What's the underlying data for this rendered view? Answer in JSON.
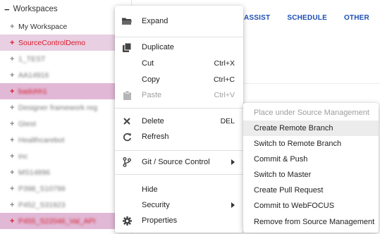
{
  "tree": {
    "root_label": "Workspaces",
    "items": [
      {
        "label": "My Workspace"
      },
      {
        "label": "SourceControlDemo"
      },
      {
        "label": "1_TEST"
      },
      {
        "label": "AA14916"
      },
      {
        "label": "badohh1"
      },
      {
        "label": "Designer framework reg"
      },
      {
        "label": "Gtest"
      },
      {
        "label": "Healthcarebot"
      },
      {
        "label": "inc"
      },
      {
        "label": "MS14896"
      },
      {
        "label": "P398_S10799"
      },
      {
        "label": "P452_S31923"
      },
      {
        "label": "P455_S22046_Val_API"
      }
    ]
  },
  "tabs": [
    {
      "label": "ASSIST"
    },
    {
      "label": "SCHEDULE"
    },
    {
      "label": "OTHER"
    }
  ],
  "context_menu": {
    "expand": "Expand",
    "duplicate": "Duplicate",
    "cut": "Cut",
    "cut_shortcut": "Ctrl+X",
    "copy": "Copy",
    "copy_shortcut": "Ctrl+C",
    "paste": "Paste",
    "paste_shortcut": "Ctrl+V",
    "delete": "Delete",
    "delete_shortcut": "DEL",
    "refresh": "Refresh",
    "git": "Git / Source Control",
    "hide": "Hide",
    "security": "Security",
    "properties": "Properties"
  },
  "submenu": {
    "items": [
      {
        "label": "Place under Source Management",
        "disabled": true
      },
      {
        "label": "Create Remote Branch",
        "hover": true
      },
      {
        "label": "Switch to Remote Branch"
      },
      {
        "label": "Commit & Push"
      },
      {
        "label": "Switch to Master"
      },
      {
        "label": "Create Pull Request"
      },
      {
        "label": "Commit to WebFOCUS"
      },
      {
        "label": "Remove from Source Management"
      }
    ]
  },
  "colors": {
    "accent_red": "#d91a2a",
    "tab_blue": "#1b4fb3",
    "selection_pink": "#e8cfe1",
    "hover_grey": "#ececec"
  },
  "icons": {
    "expand": "folder-icon",
    "duplicate": "duplicate-icon",
    "paste": "clipboard-icon",
    "delete": "close-icon",
    "refresh": "refresh-icon",
    "git": "git-branch-icon",
    "properties": "gear-icon"
  }
}
